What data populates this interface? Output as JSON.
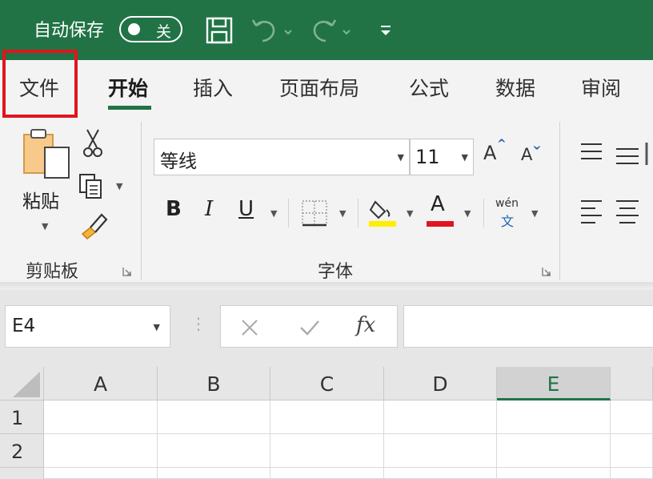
{
  "titlebar": {
    "autosave_label": "自动保存",
    "autosave_state": "关",
    "icons": [
      "save-icon",
      "undo-icon",
      "redo-icon",
      "customize-toolbar-icon"
    ]
  },
  "tabs": [
    {
      "label": "文件",
      "active": false
    },
    {
      "label": "开始",
      "active": true
    },
    {
      "label": "插入",
      "active": false
    },
    {
      "label": "页面布局",
      "active": false
    },
    {
      "label": "公式",
      "active": false
    },
    {
      "label": "数据",
      "active": false
    },
    {
      "label": "审阅",
      "active": false
    }
  ],
  "ribbon": {
    "clipboard": {
      "paste_label": "粘贴",
      "group_label": "剪贴板"
    },
    "font": {
      "font_name": "等线",
      "font_size": "11",
      "grow_font": "A",
      "shrink_font": "A",
      "bold": "B",
      "italic": "I",
      "underline": "U",
      "font_color": "A",
      "phonetic_top": "wén",
      "phonetic_bottom": "文",
      "group_label": "字体"
    }
  },
  "formula_bar": {
    "name_box": "E4",
    "fx": "fx",
    "formula": ""
  },
  "grid": {
    "columns": [
      "A",
      "B",
      "C",
      "D",
      "E"
    ],
    "selected_column": "E",
    "rows": [
      "1",
      "2"
    ]
  },
  "colors": {
    "accent": "#217346",
    "highlight_border": "#e0151e",
    "fill_color": "#ffee00",
    "font_color": "#e0151e"
  }
}
